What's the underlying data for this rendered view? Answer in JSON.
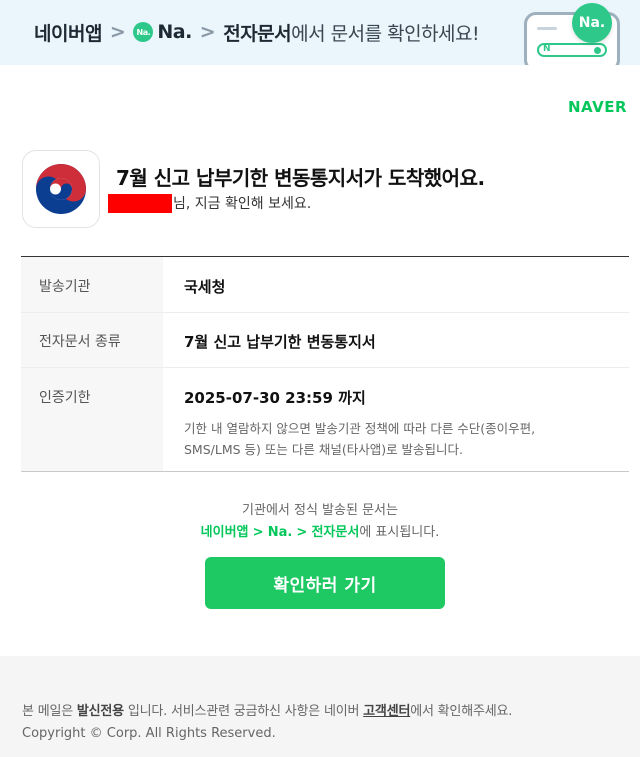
{
  "banner": {
    "crumb_1": "네이버앱",
    "sep": ">",
    "na_badge": "Na.",
    "crumb_2": "Na.",
    "crumb_3": "전자문서",
    "suffix": "에서 문서를 확인하세요!",
    "phone_badge": "Na.",
    "phone_n": "N"
  },
  "brand": {
    "logo": "NAVER",
    "color": "#03c75a"
  },
  "header": {
    "title": "7월 신고 납부기한 변동통지서가 도착했어요.",
    "subtitle": "님, 지금 확인해 보세요."
  },
  "info": {
    "rows": [
      {
        "label": "발송기관",
        "value": "국세청"
      },
      {
        "label": "전자문서 종류",
        "value": "7월 신고 납부기한 변동통지서"
      },
      {
        "label": "인증기한",
        "value": "2025-07-30 23:59 까지",
        "note": "기한 내 열람하지 않으면 발송기관 정책에 따라 다른 수단(종이우편, SMS/LMS 등) 또는 다른 채널(타사앱)로 발송됩니다."
      }
    ]
  },
  "notice": {
    "line1": "기관에서 정식 발송된 문서는",
    "path_1": "네이버앱",
    "path_sep": ">",
    "path_2": "Na.",
    "path_3": "전자문서",
    "line2_suffix": "에 표시됩니다."
  },
  "cta": {
    "label": "확인하러 가기",
    "color": "#1ec862"
  },
  "footer": {
    "p1": "본 메일은 ",
    "p1_bold": "발신전용",
    "p2": " 입니다. 서비스관련 궁금하신 사항은 네이버 ",
    "link": "고객센터",
    "p3": "에서 확인해주세요.",
    "copyright": "Copyright © Corp. All Rights Reserved."
  }
}
